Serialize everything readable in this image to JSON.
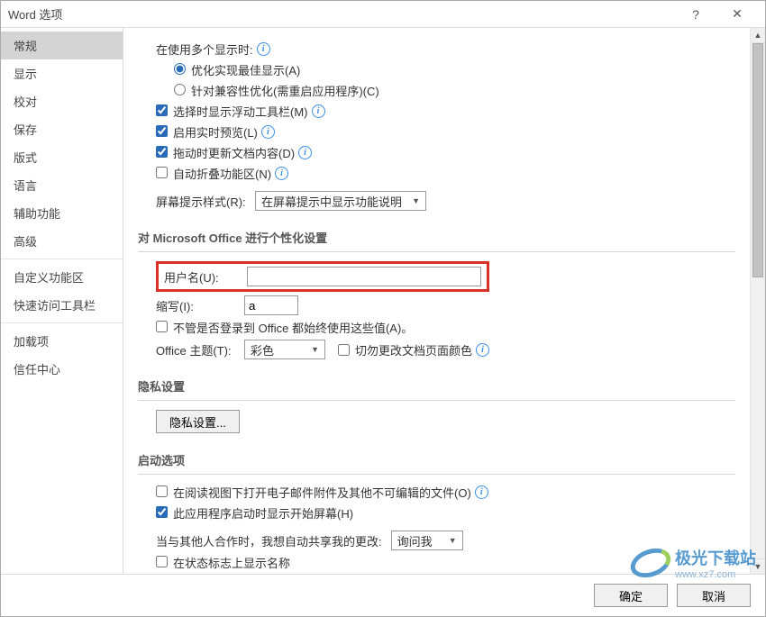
{
  "title": "Word 选项",
  "sidebar": {
    "items": [
      {
        "label": "常规",
        "active": true
      },
      {
        "label": "显示"
      },
      {
        "label": "校对"
      },
      {
        "label": "保存"
      },
      {
        "label": "版式"
      },
      {
        "label": "语言"
      },
      {
        "label": "辅助功能"
      },
      {
        "label": "高级"
      },
      {
        "label": "自定义功能区"
      },
      {
        "label": "快速访问工具栏"
      },
      {
        "label": "加载项"
      },
      {
        "label": "信任中心"
      }
    ]
  },
  "ui_options": {
    "multi_display_label": "在使用多个显示时:",
    "radio_optimize": "优化实现最佳显示(A)",
    "radio_compat": "针对兼容性优化(需重启应用程序)(C)",
    "cb_minibar": "选择时显示浮动工具栏(M)",
    "cb_live_preview": "启用实时预览(L)",
    "cb_drag_update": "拖动时更新文档内容(D)",
    "cb_auto_collapse": "自动折叠功能区(N)",
    "screen_tip_label": "屏幕提示样式(R):",
    "screen_tip_value": "在屏幕提示中显示功能说明"
  },
  "personalize": {
    "section_title": "对 Microsoft Office 进行个性化设置",
    "username_label": "用户名(U):",
    "username_value": "",
    "initials_label": "缩写(I):",
    "initials_value": "a",
    "cb_always_use": "不管是否登录到 Office 都始终使用这些值(A)。",
    "theme_label": "Office 主题(T):",
    "theme_value": "彩色",
    "cb_no_change_bg": "切勿更改文档页面颜色"
  },
  "privacy": {
    "section_title": "隐私设置",
    "button": "隐私设置..."
  },
  "startup": {
    "section_title": "启动选项",
    "cb_reading_view": "在阅读视图下打开电子邮件附件及其他不可编辑的文件(O)",
    "cb_start_screen": "此应用程序启动时显示开始屏幕(H)",
    "collab_label": "当与其他人合作时，我想自动共享我的更改:",
    "collab_value": "询问我",
    "cb_status_name": "在状态标志上显示名称"
  },
  "buttons": {
    "ok": "确定",
    "cancel": "取消"
  },
  "watermark": {
    "text": "极光下载站",
    "url": "www.xz7.com"
  }
}
